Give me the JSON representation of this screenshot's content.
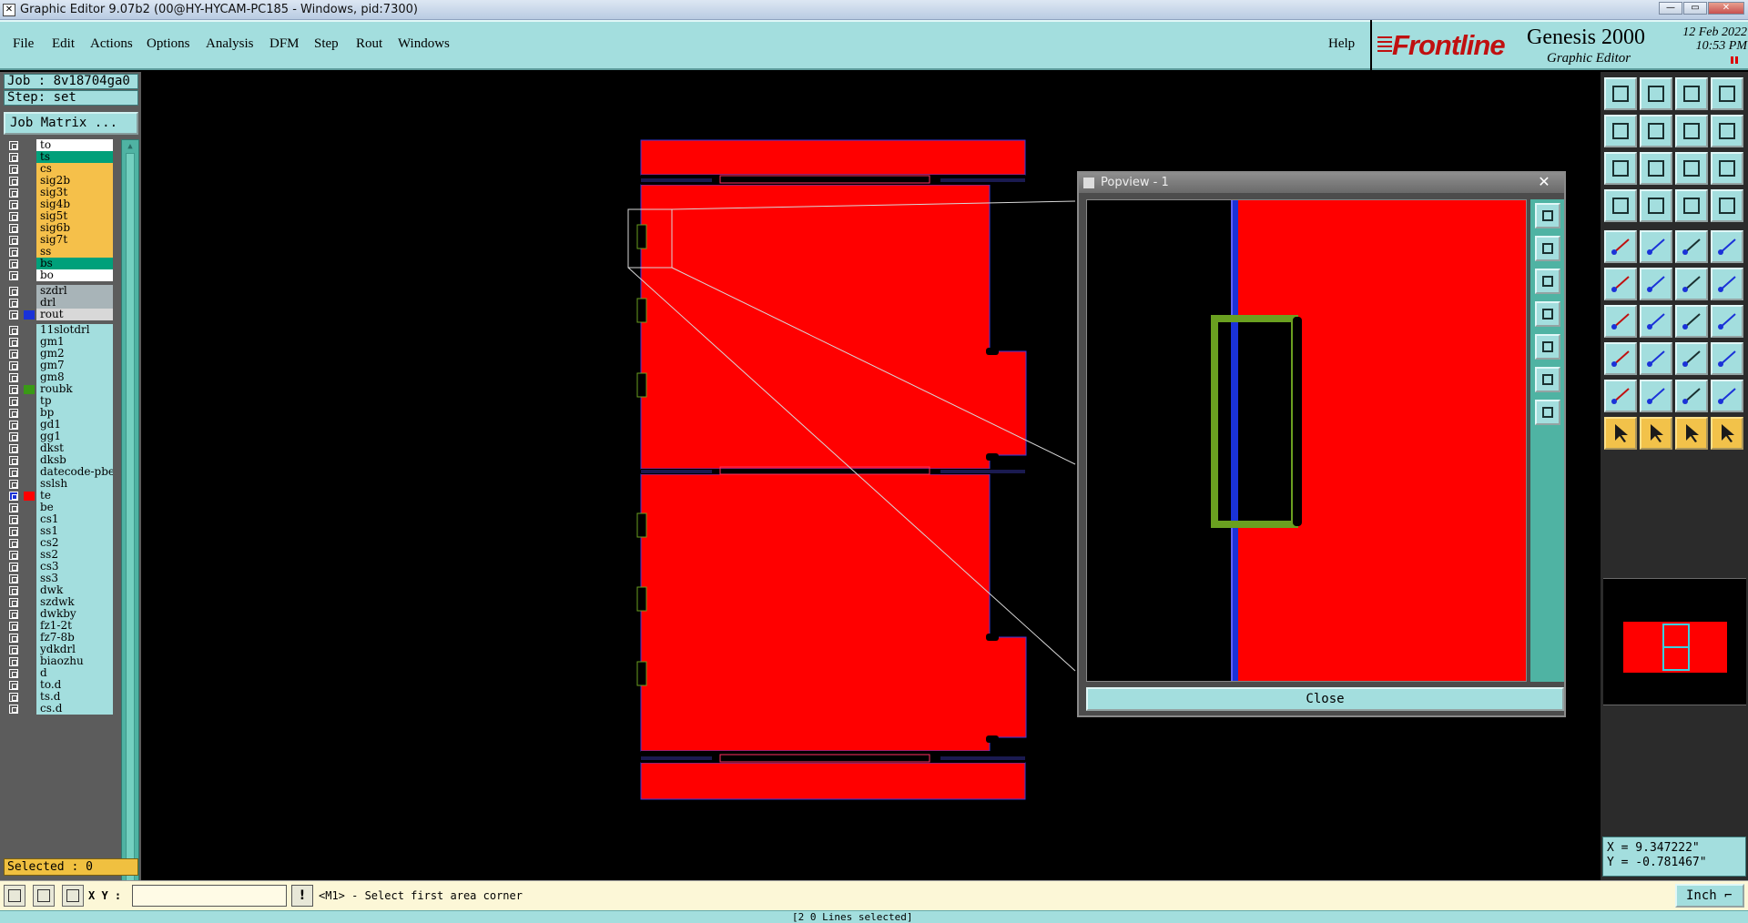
{
  "window": {
    "title": "Graphic Editor 9.07b2 (00@HY-HYCAM-PC185 - Windows, pid:7300)",
    "controls": [
      "—",
      "▭",
      "✕"
    ]
  },
  "menu": {
    "items": [
      "File",
      "Edit",
      "Actions",
      "Options",
      "Analysis",
      "DFM",
      "Step",
      "Rout",
      "Windows"
    ],
    "help": "Help"
  },
  "brand": {
    "logo": "Frontline",
    "product": "Genesis 2000",
    "subtitle": "Graphic Editor",
    "date": "12 Feb 2022",
    "time": "10:53 PM"
  },
  "job": {
    "job_line": "Job : 8v18704ga0",
    "step_line": "Step: set",
    "matrix_button": "Job Matrix ...",
    "selected": "Selected : 0"
  },
  "layers": [
    {
      "name": "to",
      "color": "#ffffff"
    },
    {
      "name": "ts",
      "color": "#00a07a"
    },
    {
      "name": "cs",
      "color": "#f5c04a"
    },
    {
      "name": "sig2b",
      "color": "#f5c04a"
    },
    {
      "name": "sig3t",
      "color": "#f5c04a"
    },
    {
      "name": "sig4b",
      "color": "#f5c04a"
    },
    {
      "name": "sig5t",
      "color": "#f5c04a"
    },
    {
      "name": "sig6b",
      "color": "#f5c04a"
    },
    {
      "name": "sig7t",
      "color": "#f5c04a"
    },
    {
      "name": "ss",
      "color": "#f5c04a"
    },
    {
      "name": "bs",
      "color": "#00a07a"
    },
    {
      "name": "bo",
      "color": "#ffffff"
    },
    {
      "name": "szdrl",
      "color": "#a8b4b8"
    },
    {
      "name": "drl",
      "color": "#a8b4b8"
    },
    {
      "name": "rout",
      "color": "#d8d8d8",
      "swatch": "#1a32d8"
    },
    {
      "name": "11slotdrl",
      "color": "#a3dede"
    },
    {
      "name": "gm1",
      "color": "#a3dede"
    },
    {
      "name": "gm2",
      "color": "#a3dede"
    },
    {
      "name": "gm7",
      "color": "#a3dede"
    },
    {
      "name": "gm8",
      "color": "#a3dede"
    },
    {
      "name": "roubk",
      "color": "#a3dede",
      "swatch": "#3a9a16"
    },
    {
      "name": "tp",
      "color": "#a3dede"
    },
    {
      "name": "bp",
      "color": "#a3dede"
    },
    {
      "name": "gd1",
      "color": "#a3dede"
    },
    {
      "name": "gg1",
      "color": "#a3dede"
    },
    {
      "name": "dkst",
      "color": "#a3dede"
    },
    {
      "name": "dksb",
      "color": "#a3dede"
    },
    {
      "name": "datecode-pbe",
      "color": "#a3dede"
    },
    {
      "name": "sslsh",
      "color": "#a3dede"
    },
    {
      "name": "te",
      "color": "#a3dede",
      "swatch": "#ff0000",
      "active": true
    },
    {
      "name": "be",
      "color": "#a3dede"
    },
    {
      "name": "cs1",
      "color": "#a3dede"
    },
    {
      "name": "ss1",
      "color": "#a3dede"
    },
    {
      "name": "cs2",
      "color": "#a3dede"
    },
    {
      "name": "ss2",
      "color": "#a3dede"
    },
    {
      "name": "cs3",
      "color": "#a3dede"
    },
    {
      "name": "ss3",
      "color": "#a3dede"
    },
    {
      "name": "dwk",
      "color": "#a3dede"
    },
    {
      "name": "szdwk",
      "color": "#a3dede"
    },
    {
      "name": "dwkby",
      "color": "#a3dede"
    },
    {
      "name": "fz1-2t",
      "color": "#a3dede"
    },
    {
      "name": "fz7-8b",
      "color": "#a3dede"
    },
    {
      "name": "ydkdrl",
      "color": "#a3dede"
    },
    {
      "name": "biaozhu",
      "color": "#a3dede"
    },
    {
      "name": "d",
      "color": "#a3dede"
    },
    {
      "name": "to.d",
      "color": "#a3dede"
    },
    {
      "name": "ts.d",
      "color": "#a3dede"
    },
    {
      "name": "cs.d",
      "color": "#a3dede"
    }
  ],
  "colors": {
    "board_fill": "#ff0000",
    "rout_outline": "#1a32d8",
    "roubk": "#6aa020",
    "panel_teal": "#a3dede"
  },
  "popview": {
    "title": "Popview - 1",
    "close_x": "✕",
    "close_button": "Close",
    "tools": [
      "zoom-home-icon",
      "zoom-in-icon",
      "zoom-out-icon",
      "pan-left-icon",
      "pan-right-icon",
      "fit-icon",
      "center-icon"
    ]
  },
  "toolbar": {
    "groups": [
      [
        "zoom-home-icon",
        "zoom-in-icon",
        "home-icon",
        "window-icon"
      ],
      [
        "pan-left-icon",
        "pan-right-icon",
        "zoom-back-icon",
        "redraw-icon"
      ],
      [
        "zoom-fit-icon",
        "zoom-center-icon",
        "one-to-one-icon",
        "help-query-icon"
      ],
      [
        "snap-icon",
        "grid-icon",
        "layers-icon",
        "filter-icon"
      ],
      [
        "camera-icon",
        "highlight-icon",
        "ruler-icon",
        "pad-icon"
      ],
      [
        "connect-icon",
        "cross-icon",
        "line-point-icon",
        "line-dot-icon"
      ],
      [
        "add-line-icon",
        "edit-line-icon",
        "arc-icon",
        "split-icon"
      ],
      [
        "move-icon",
        "minus-icon",
        "resize-icon",
        "shapes-icon"
      ],
      [
        "triangle-icon",
        "triangle-a-icon",
        "triangle-b-icon",
        "triangle-c-icon"
      ],
      [
        "select-arrow-icon",
        "select-area-icon",
        "select-arrow-alt-icon",
        "select-net-icon"
      ]
    ]
  },
  "coords": {
    "x": "X = 9.347222\"",
    "y": "Y = -0.781467\""
  },
  "status": {
    "xy_label": "X Y :",
    "xy_value": "",
    "bang": "!",
    "prompt": "<M1> - Select first area corner",
    "units": "Inch",
    "bottom": "[2 0 Lines selected]"
  }
}
